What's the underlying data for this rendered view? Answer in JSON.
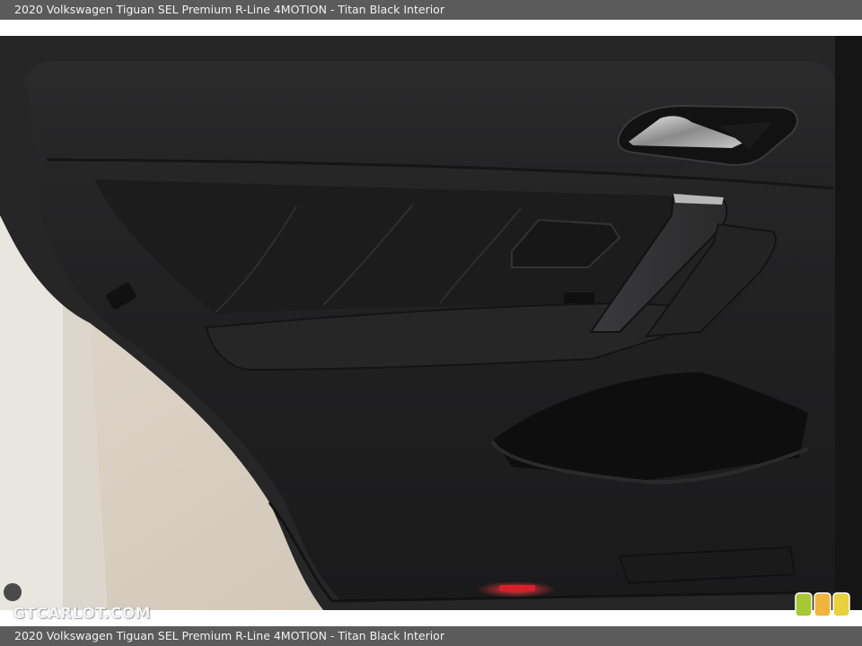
{
  "caption": {
    "top": "2020 Volkswagen Tiguan SEL Premium R-Line 4MOTION - Titan Black Interior",
    "bottom": "2020 Volkswagen Tiguan SEL Premium R-Line 4MOTION - Titan Black Interior"
  },
  "watermark": {
    "text": "GTCARLOT.COM"
  },
  "colors": {
    "caption_bar": "#5b5b5b",
    "door_panel": "#1f1f20",
    "floor": "#d8cfc2",
    "ambient_light": "#d8202a",
    "badge_green": "#a6c832",
    "badge_orange": "#f0b43c",
    "badge_yellow": "#e8d23c"
  },
  "photo": {
    "subject": "rear-door-panel",
    "icons": [
      "door-handle-icon",
      "window-switch-icon",
      "badge-icon"
    ]
  }
}
